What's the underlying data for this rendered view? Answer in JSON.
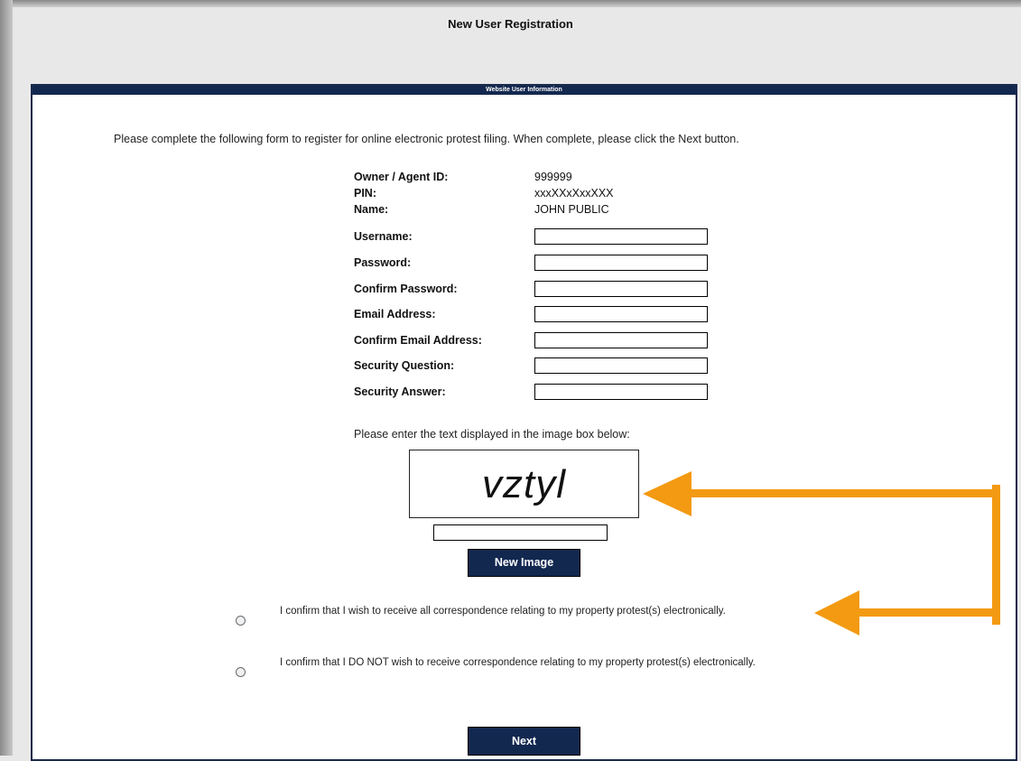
{
  "page_title": "New User Registration",
  "section_header": "Website User Information",
  "intro_text": "Please complete the following form to register for online electronic protest filing. When complete, please click the Next button.",
  "info": {
    "owner_agent_label": "Owner / Agent ID:",
    "owner_agent_value": "999999",
    "pin_label": "PIN:",
    "pin_value": "xxxXXxXxxXXX",
    "name_label": "Name:",
    "name_value": "JOHN PUBLIC"
  },
  "fields": {
    "username": "Username:",
    "password": "Password:",
    "confirm_password": "Confirm Password:",
    "email": "Email Address:",
    "confirm_email": "Confirm Email Address:",
    "security_question": "Security Question:",
    "security_answer": "Security Answer:"
  },
  "captcha": {
    "prompt": "Please enter the text displayed in the image box below:",
    "image_text": "vztyl",
    "new_image_button": "New Image"
  },
  "options": {
    "electronic_yes": "I confirm that I wish to receive all correspondence relating to my property protest(s) electronically.",
    "electronic_no": "I confirm that I DO NOT wish to receive correspondence relating to my property protest(s) electronically."
  },
  "next_button": "Next",
  "colors": {
    "header_navy": "#13284f",
    "annotation_arrow": "#f39a12"
  }
}
